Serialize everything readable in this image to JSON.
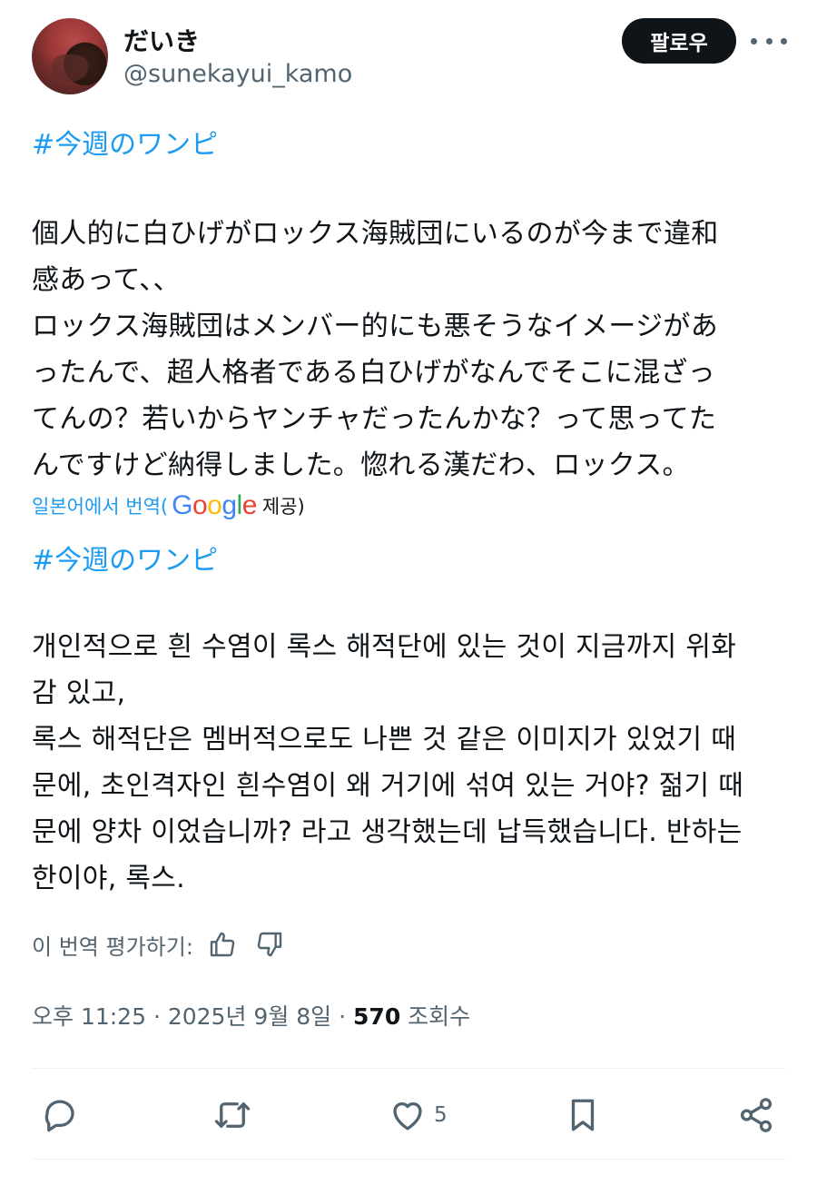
{
  "user": {
    "display_name": "だいき",
    "handle": "@sunekayui_kamo"
  },
  "follow_button": {
    "label": "팔로우"
  },
  "tweet": {
    "hashtag_original": "#今週のワンピ",
    "text_original": "個人的に白ひげがロックス海賊団にいるのが今まで違和\n感あって、、\nロックス海賊団はメンバー的にも悪そうなイメージがあ\nったんで、超人格者である白ひげがなんでそこに混ざっ\nてんの？若いからヤンチャだったんかな？って思ってた\nんですけど納得しました。惚れる漢だわ、ロックス。",
    "translation_label_prefix": "일본어에서 번역(",
    "translation_provider": "Google",
    "translation_label_suffix": " 제공)",
    "hashtag_translated": "#今週のワンピ",
    "text_translated": "개인적으로 흰 수염이 록스 해적단에 있는 것이 지금까지 위화\n감 있고,\n록스 해적단은 멤버적으로도 나쁜 것 같은 이미지가 있었기 때\n문에, 초인격자인 흰수염이 왜 거기에 섞여 있는 거야? 젊기 때\n문에 양차 이었습니까? 라고 생각했는데 납득했습니다. 반하는\n한이야, 록스.",
    "rate_translation_label": "이 번역 평가하기:"
  },
  "meta": {
    "time": "오후 11:25",
    "separator": " · ",
    "date": "2025년 9월 8일",
    "views_count": "570",
    "views_label": "조회수"
  },
  "actions": {
    "like_count": "5"
  },
  "icons": {
    "reply": "reply-icon",
    "retweet": "retweet-icon",
    "like": "heart-icon",
    "bookmark": "bookmark-icon",
    "share": "share-icon",
    "more": "more-icon",
    "thumbs_up": "thumbs-up-icon",
    "thumbs_down": "thumbs-down-icon"
  },
  "colors": {
    "accent": "#1d9bf0",
    "text": "#0f1419",
    "muted": "#536471"
  }
}
